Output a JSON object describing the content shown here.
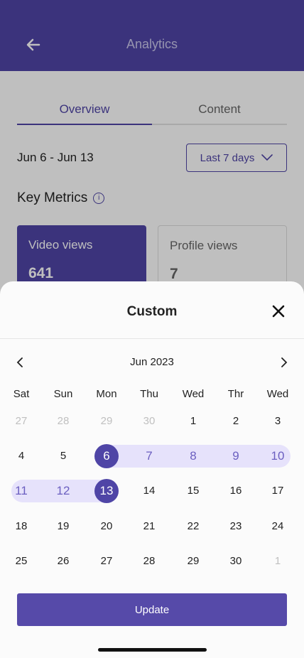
{
  "header": {
    "title": "Analytics"
  },
  "tabs": [
    {
      "label": "Overview"
    },
    {
      "label": "Content"
    }
  ],
  "range_text": "Jun 6 - Jun 13",
  "range_dropdown": {
    "label": "Last 7 days"
  },
  "section_title": "Key Metrics",
  "metrics": [
    {
      "label": "Video views",
      "value": "641"
    },
    {
      "label": "Profile views",
      "value": "7"
    }
  ],
  "sheet": {
    "title": "Custom",
    "month_label": "Jun 2023",
    "weekdays": [
      "Sat",
      "Sun",
      "Mon",
      "Thu",
      "Wed",
      "Thr",
      "Wed"
    ],
    "weeks": [
      [
        "27",
        "28",
        "29",
        "30",
        "1",
        "2",
        "3"
      ],
      [
        "4",
        "5",
        "6",
        "7",
        "8",
        "9",
        "10"
      ],
      [
        "11",
        "12",
        "13",
        "14",
        "15",
        "16",
        "17"
      ],
      [
        "18",
        "19",
        "20",
        "21",
        "22",
        "23",
        "24"
      ],
      [
        "25",
        "26",
        "27",
        "28",
        "29",
        "30",
        "1"
      ]
    ],
    "selected_start": "6",
    "selected_end": "13",
    "update_label": "Update"
  },
  "colors": {
    "accent": "#4f45a6",
    "range_bg": "#e6e2fb",
    "muted": "#c0c0c0"
  }
}
